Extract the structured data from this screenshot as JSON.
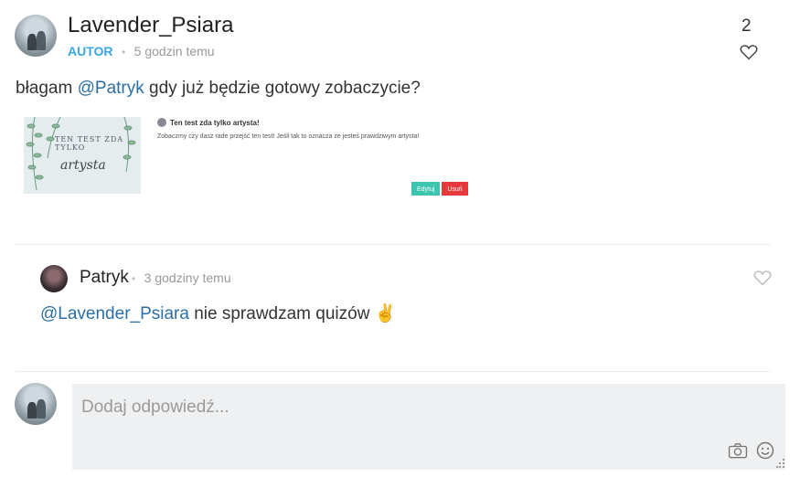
{
  "post": {
    "author": "Lavender_Psiara",
    "badge": "AUTOR",
    "separator": "•",
    "time": "5 godzin temu",
    "likes": "2",
    "text_prefix": "błagam ",
    "mention": "@Patryk",
    "text_suffix": " gdy już będzie gotowy zobaczycie?",
    "card": {
      "image_line1": "TEN TEST ZDA TYLKO",
      "image_line2": "artysta",
      "title": "Ten test zda tylko artysta!",
      "description": "Zobaczmy czy dasz rade przejść ten test! Jeśli tak to oznacza że jesteś prawdziwym artysta!",
      "edit_label": "Edytuj",
      "delete_label": "Usuń"
    }
  },
  "reply": {
    "author": "Patryk",
    "separator": "•",
    "time": "3 godziny temu",
    "mention": "@Lavender_Psiara",
    "text": " nie sprawdzam quizów ",
    "emoji": "✌"
  },
  "compose": {
    "placeholder": "Dodaj odpowiedź..."
  },
  "icons": {
    "like": "heart-icon",
    "camera": "camera-icon",
    "emoji": "smile-icon"
  },
  "colors": {
    "accent": "#3aa6e3",
    "mention": "#2a6ea5",
    "edit": "#3ec5b0",
    "delete": "#e6393b"
  }
}
